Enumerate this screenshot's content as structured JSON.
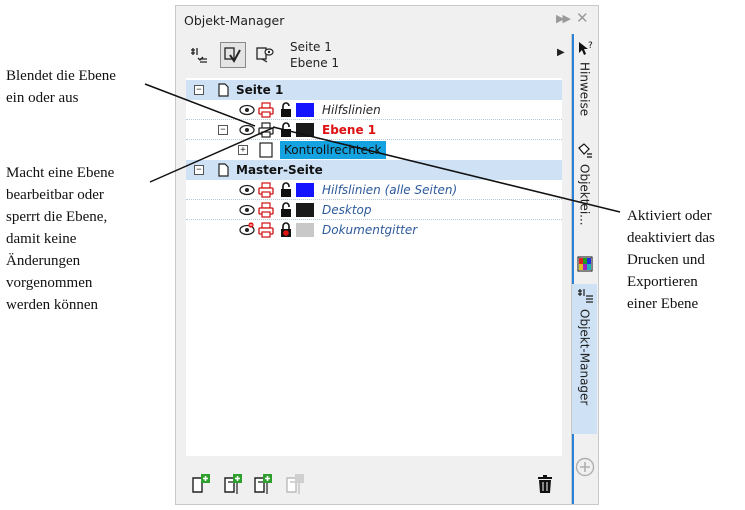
{
  "callouts": {
    "left_top": [
      "Blendet die Ebene",
      "ein oder aus"
    ],
    "left_mid": [
      "Macht eine Ebene",
      "bearbeitbar oder",
      "sperrt die Ebene,",
      "damit keine",
      "Änderungen",
      "vorgenommen",
      "werden können"
    ],
    "right": [
      "Aktiviert oder",
      "deaktiviert das",
      "Drucken und",
      "Exportieren",
      "einer Ebene"
    ]
  },
  "panel": {
    "title": "Objekt-Manager",
    "page_label": "Seite 1",
    "layer_label": "Ebene 1"
  },
  "tree": {
    "page1": "Seite 1",
    "hilfslinien": "Hilfslinien",
    "ebene1": "Ebene 1",
    "kontrollrechteck": "Kontrollrechteck",
    "master": "Master-Seite",
    "hilfslinien_alle": "Hilfslinien (alle Seiten)",
    "desktop": "Desktop",
    "dokumentgitter": "Dokumentgitter"
  },
  "side_tabs": {
    "hinweise": "Hinweise",
    "objekteigenschaften": "Objektei...",
    "objektmanager": "Objekt-Manager"
  },
  "colors": {
    "accent_blue": "#1414ff",
    "dark_swatch": "#1a1a1a",
    "grey_swatch": "#c8c8c8",
    "selection": "#14a3e0",
    "header_bg": "#cfe2f5",
    "active_layer_text": "#dd1111"
  }
}
